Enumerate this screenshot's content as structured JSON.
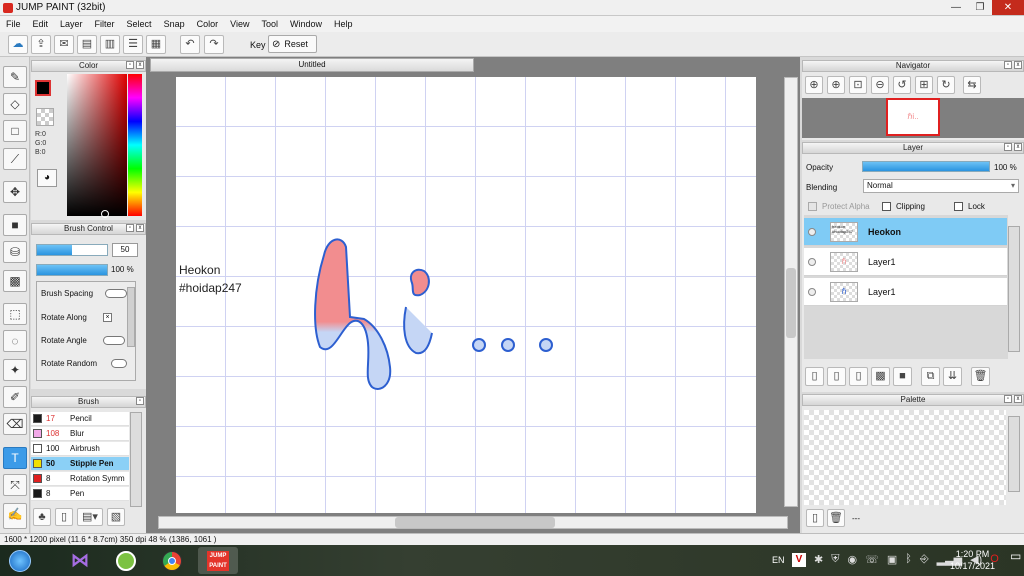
{
  "window": {
    "title": "JUMP PAINT (32bit)",
    "min": "—",
    "max": "❐",
    "close": "✕"
  },
  "menu": [
    "File",
    "Edit",
    "Layer",
    "Filter",
    "Select",
    "Snap",
    "Color",
    "View",
    "Tool",
    "Window",
    "Help"
  ],
  "toolbar": {
    "key_label": "Key",
    "reset_label": "Reset"
  },
  "color_panel": {
    "title": "Color",
    "r": "R:0",
    "g": "G:0",
    "b": "B:0"
  },
  "brush_control": {
    "title": "Brush Control",
    "size": "50",
    "opacity": "100 %",
    "size_fraction": 0.5,
    "opacity_fraction": 1.0,
    "spacing": "Brush Spacing",
    "rotate_along": "Rotate Along",
    "rotate_angle": "Rotate Angle",
    "rotate_random": "Rotate Random"
  },
  "brush_panel": {
    "title": "Brush",
    "items": [
      {
        "size": "17",
        "name": "Pencil",
        "color": "#1a1a1a",
        "sizecolor": "#d33"
      },
      {
        "size": "108",
        "name": "Blur",
        "color": "#f2a8e8",
        "sizecolor": "#d33"
      },
      {
        "size": "100",
        "name": "Airbrush",
        "color": "#ffffff",
        "sizecolor": "#111"
      },
      {
        "size": "50",
        "name": "Stipple Pen",
        "color": "#f0e000",
        "sizecolor": "#111"
      },
      {
        "size": "8",
        "name": "Rotation Symm",
        "color": "#e02020",
        "sizecolor": "#111"
      },
      {
        "size": "8",
        "name": "Pen",
        "color": "#1a1a1a",
        "sizecolor": "#111"
      }
    ]
  },
  "canvas": {
    "tab": "Untitled",
    "text_line1": "Heokon",
    "text_line2": "#hoidap247"
  },
  "navigator": {
    "title": "Navigator"
  },
  "layer_panel": {
    "title": "Layer",
    "opacity_label": "Opacity",
    "opacity_value": "100 %",
    "opacity_fraction": 1.0,
    "blending_label": "Blending",
    "blending_value": "Normal",
    "protect_alpha": "Protect Alpha",
    "clipping": "Clipping",
    "lock": "Lock",
    "layers": [
      {
        "name": "Heokon",
        "thumb": "heokon #hoidap247"
      },
      {
        "name": "Layer1",
        "thumb": ""
      },
      {
        "name": "Layer1",
        "thumb": ""
      }
    ]
  },
  "palette": {
    "title": "Palette",
    "footer": "---"
  },
  "status": {
    "text": "1600 * 1200 pixel   (11.6 * 8.7cm)   350 dpi   48 %   (1386, 1061 )"
  },
  "taskbar": {
    "lang": "EN",
    "time": "1:20 PM",
    "date": "10/17/2021"
  },
  "colors": {
    "accent": "#3c9be8",
    "selection": "#7fcbf5",
    "letter_pink": "#f28d8f",
    "letter_blue": "#c5d6f5",
    "letter_outline": "#2d5fd0"
  }
}
